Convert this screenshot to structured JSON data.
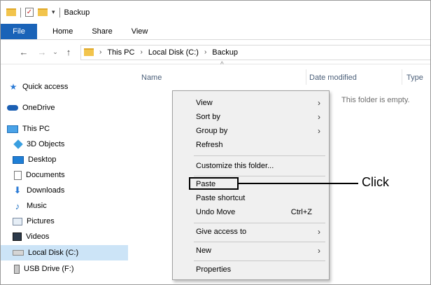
{
  "title_bar": {
    "title": "Backup"
  },
  "ribbon": {
    "tabs": [
      "File",
      "Home",
      "Share",
      "View"
    ]
  },
  "address": {
    "crumbs": [
      "This PC",
      "Local Disk (C:)",
      "Backup"
    ]
  },
  "sidebar": {
    "items": [
      {
        "label": "Quick access",
        "icon": "star-icon"
      },
      {
        "label": "OneDrive",
        "icon": "cloud-icon"
      },
      {
        "label": "This PC",
        "icon": "computer-icon"
      },
      {
        "label": "3D Objects",
        "icon": "cube-icon"
      },
      {
        "label": "Desktop",
        "icon": "desktop-icon"
      },
      {
        "label": "Documents",
        "icon": "document-icon"
      },
      {
        "label": "Downloads",
        "icon": "download-icon"
      },
      {
        "label": "Music",
        "icon": "music-icon"
      },
      {
        "label": "Pictures",
        "icon": "pictures-icon"
      },
      {
        "label": "Videos",
        "icon": "videos-icon"
      },
      {
        "label": "Local Disk (C:)",
        "icon": "disk-icon",
        "selected": true
      },
      {
        "label": "USB Drive (F:)",
        "icon": "usb-icon"
      }
    ]
  },
  "columns": {
    "name": "Name",
    "date_modified": "Date modified",
    "type": "Type"
  },
  "content": {
    "empty_message": "This folder is empty."
  },
  "context_menu": {
    "items": [
      {
        "label": "View",
        "submenu": true
      },
      {
        "label": "Sort by",
        "submenu": true
      },
      {
        "label": "Group by",
        "submenu": true
      },
      {
        "label": "Refresh"
      },
      {
        "label": "Customize this folder..."
      },
      {
        "label": "Paste"
      },
      {
        "label": "Paste shortcut"
      },
      {
        "label": "Undo Move",
        "shortcut": "Ctrl+Z"
      },
      {
        "label": "Give access to",
        "submenu": true
      },
      {
        "label": "New",
        "submenu": true
      },
      {
        "label": "Properties"
      }
    ]
  },
  "annotation": {
    "label": "Click"
  },
  "colors": {
    "file_tab": "#1a63b8",
    "selected_item": "#cce4f7",
    "menu_bg": "#f0f0f0"
  }
}
